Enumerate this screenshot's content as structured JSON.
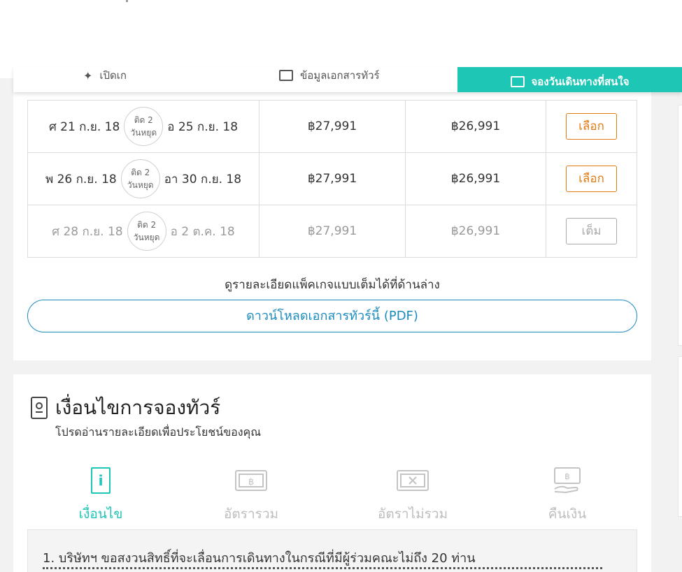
{
  "tabbar": {
    "tab1_label": "เปิดเก",
    "tab2_label": "ข้อมูลเอกสารทัวร์",
    "tab3_label": "จองวันเดินทางที่สนใจ"
  },
  "rows": [
    {
      "start": "ศ 21 ก.ย. 18",
      "badge_top": "ติด 2",
      "badge_bottom": "วันหยุด",
      "end": "อ 25 ก.ย. 18",
      "price": "฿27,991",
      "price2": "฿26,991",
      "action": "เลือก",
      "status": "available"
    },
    {
      "start": "พ 26 ก.ย. 18",
      "badge_top": "ติด 2",
      "badge_bottom": "วันหยุด",
      "end": "อา 30 ก.ย. 18",
      "price": "฿27,991",
      "price2": "฿26,991",
      "action": "เลือก",
      "status": "available"
    },
    {
      "start": "ศ 28 ก.ย. 18",
      "badge_top": "ติด 2",
      "badge_bottom": "วันหยุด",
      "end": "อ 2 ต.ค. 18",
      "price": "฿27,991",
      "price2": "฿26,991",
      "action": "เต็ม",
      "status": "full"
    }
  ],
  "detail_note": "ดูรายละเอียดแพ็คเกจแบบเต็มได้ที่ด้านล่าง",
  "pdf_button": "ดาวน์โหลดเอกสารทัวร์นี้ (PDF)",
  "conditions": {
    "title": "เงื่อนไขการจองทัวร์",
    "subtitle": "โปรดอ่านรายละเอียดเพื่อประโยชน์ของคุณ",
    "tabs": [
      {
        "label": "เงื่อนไข",
        "icon": "info-document-icon"
      },
      {
        "label": "อัตรารวม",
        "icon": "baht-banknote-icon"
      },
      {
        "label": "อัตราไม่รวม",
        "icon": "cross-banknote-icon"
      },
      {
        "label": "คืนเงิน",
        "icon": "refund-icon"
      }
    ],
    "active_tab": "เงื่อนไข",
    "item1": "1. บริษัทฯ ขอสงวนสิทธิ์ที่จะเลื่อนการเดินทางในกรณีที่มีผู้ร่วมคณะไม่ถึง 20 ท่าน"
  },
  "colors": {
    "accent": "#1ec6b6",
    "select": "#e07b16",
    "link": "#1b8bbf"
  }
}
